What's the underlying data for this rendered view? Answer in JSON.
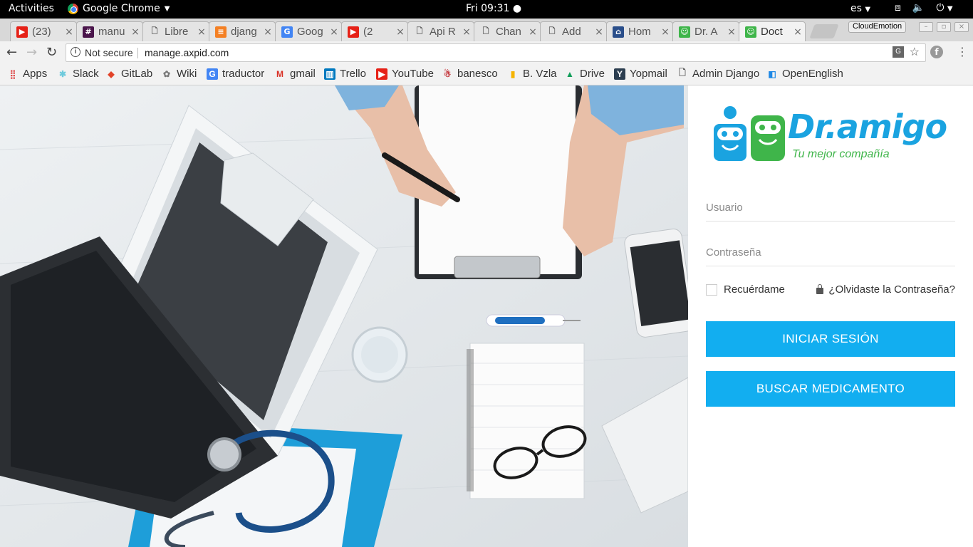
{
  "gnome": {
    "activities": "Activities",
    "app_name": "Google Chrome",
    "clock": "Fri 09:31",
    "language": "es"
  },
  "tabs": [
    {
      "title": "(23)",
      "favicon": "youtube-icon"
    },
    {
      "title": "manu",
      "favicon": "slack-icon"
    },
    {
      "title": "Libre",
      "favicon": "page-icon"
    },
    {
      "title": "djang",
      "favicon": "stackoverflow-icon"
    },
    {
      "title": "Goog",
      "favicon": "google-translate-icon"
    },
    {
      "title": "(2",
      "favicon": "youtube-icon"
    },
    {
      "title": "Api R",
      "favicon": "page-icon"
    },
    {
      "title": "Chan",
      "favicon": "page-icon"
    },
    {
      "title": "Add",
      "favicon": "page-icon"
    },
    {
      "title": "Hom",
      "favicon": "site-icon"
    },
    {
      "title": "Dr. A",
      "favicon": "dr-amigo-icon"
    },
    {
      "title": "Doct",
      "favicon": "dr-amigo-icon",
      "active": true
    }
  ],
  "tab_close": "×",
  "profile_name": "CloudEmotion",
  "address_bar": {
    "security": "Not secure",
    "url": "manage.axpid.com"
  },
  "bookmarks": [
    {
      "label": "Apps",
      "icon": "apps-grid-icon"
    },
    {
      "label": "Slack",
      "icon": "slack-icon"
    },
    {
      "label": "GitLab",
      "icon": "gitlab-icon"
    },
    {
      "label": "Wiki",
      "icon": "wiki-icon"
    },
    {
      "label": "traductor",
      "icon": "google-translate-icon"
    },
    {
      "label": "gmail",
      "icon": "gmail-icon"
    },
    {
      "label": "Trello",
      "icon": "trello-icon"
    },
    {
      "label": "YouTube",
      "icon": "youtube-icon"
    },
    {
      "label": "banesco",
      "icon": "banesco-icon"
    },
    {
      "label": "B. Vzla",
      "icon": "bvzla-icon"
    },
    {
      "label": "Drive",
      "icon": "drive-icon"
    },
    {
      "label": "Yopmail",
      "icon": "yopmail-icon"
    },
    {
      "label": "Admin Django",
      "icon": "page-icon"
    },
    {
      "label": "OpenEnglish",
      "icon": "openenglish-icon"
    }
  ],
  "login": {
    "logo_text": "Dr.amigo",
    "logo_tagline": "Tu mejor compañía",
    "username_placeholder": "Usuario",
    "password_placeholder": "Contraseña",
    "remember_label": "Recuérdame",
    "forgot_label": "¿Olvidaste la Contraseña?",
    "login_button": "INICIAR SESIÓN",
    "search_button": "BUSCAR MEDICAMENTO"
  },
  "colors": {
    "accent": "#12aef0",
    "logo_blue": "#1aa3e0",
    "logo_green": "#3fb54a"
  }
}
